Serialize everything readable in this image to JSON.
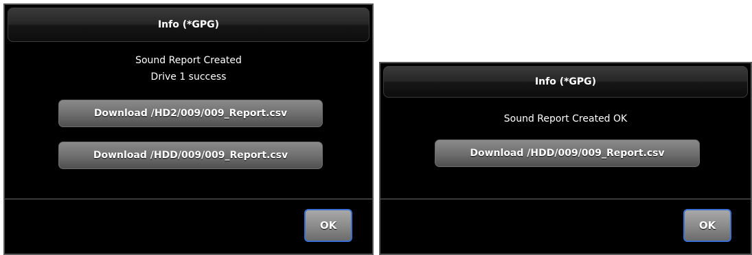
{
  "dialogs": [
    {
      "title": "Info (*GPG)",
      "messages": [
        "Sound Report Created",
        "Drive 1 success"
      ],
      "downloads": [
        "Download /HD2/009/009_Report.csv",
        "Download /HDD/009/009_Report.csv"
      ],
      "ok_label": "OK"
    },
    {
      "title": "Info (*GPG)",
      "messages": [
        "Sound Report Created OK"
      ],
      "downloads": [
        "Download /HDD/009/009_Report.csv"
      ],
      "ok_label": "OK"
    }
  ],
  "colors": {
    "background": "#000000",
    "text": "#ffffff",
    "button_gray": "#707070",
    "focus_border": "#3b6fd1"
  }
}
